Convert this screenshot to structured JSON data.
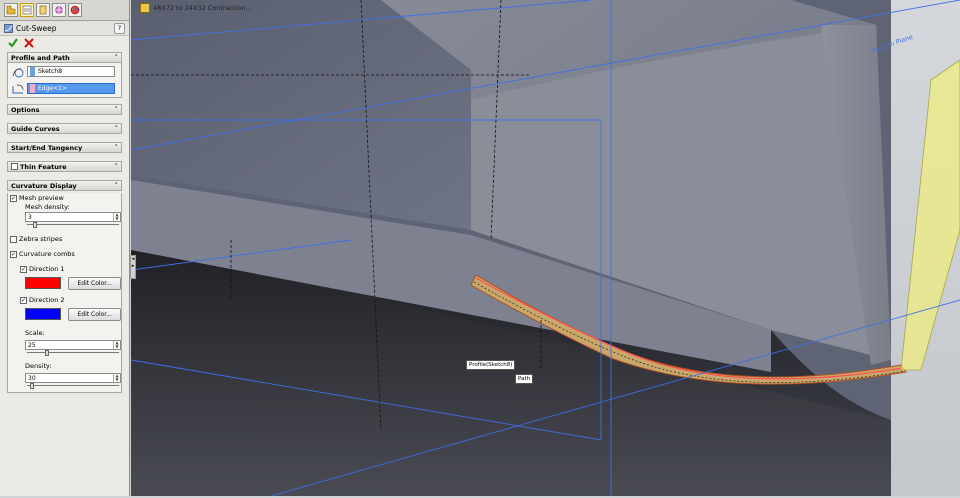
{
  "panel": {
    "feature_name": "Cut-Sweep",
    "help": "?",
    "sections": {
      "profile_and_path": {
        "title": "Profile and Path",
        "profile_value": "Sketch8",
        "path_value": "Edge<1>"
      },
      "options": {
        "title": "Options"
      },
      "guide_curves": {
        "title": "Guide Curves"
      },
      "start_end_tangency": {
        "title": "Start/End Tangency"
      },
      "thin_feature": {
        "title": "Thin Feature"
      },
      "curvature_display": {
        "title": "Curvature Display",
        "mesh_preview": "Mesh preview",
        "mesh_density_label": "Mesh density:",
        "mesh_density_value": "3",
        "zebra_stripes": "Zebra stripes",
        "curvature_combs": "Curvature combs",
        "direction1": "Direction 1",
        "direction1_color": "#ff0000",
        "direction2": "Direction 2",
        "direction2_color": "#0000ff",
        "edit_color": "Edit Color...",
        "scale_label": "Scale:",
        "scale_value": "25",
        "density_label": "Density:",
        "density_value": "30"
      }
    }
  },
  "viewport": {
    "breadcrumb": "48X72 to 24X32 Contraction...",
    "plane_label": "Section Plane",
    "profile_callout": "Profile(Sketch8)",
    "path_callout": "Path"
  }
}
